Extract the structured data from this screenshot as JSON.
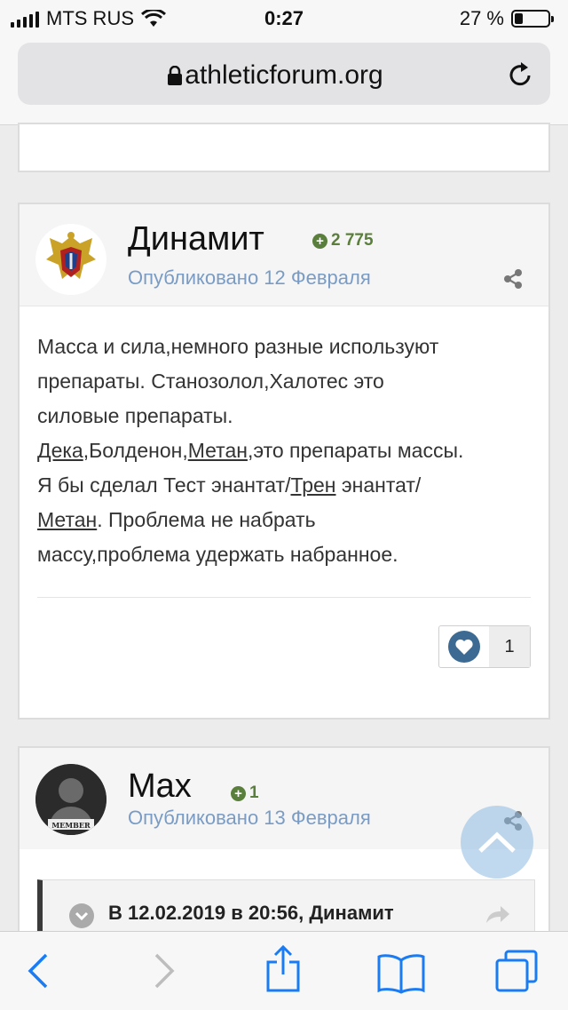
{
  "status_bar": {
    "carrier": "MTS RUS",
    "time": "0:27",
    "battery": "27 %"
  },
  "url_bar": {
    "domain": "athleticforum.org",
    "icons": [
      "lock-icon",
      "reload-icon"
    ]
  },
  "posts": [
    {
      "author": "Динамит",
      "reputation": "2 775",
      "posted": "Опубликовано 12 Февраля",
      "body": {
        "line1": "Масса и сила,немного разные используют",
        "line2": "препараты. Станозолол,Халотес это",
        "line3": "силовые препараты.",
        "deka": "Дека",
        "sep1": ",Болденон,",
        "metan1": "Метан",
        "line4_rest": ",это препараты массы.",
        "line5_pre": "Я бы сделал Тест энантат/",
        "tren": "Трен",
        "line5_post": " энантат/",
        "metan2": "Метан",
        "line6_rest": ". Проблема не набрать",
        "line7": "массу,проблема удержать набранное."
      },
      "likes": "1"
    },
    {
      "author": "Max",
      "reputation": "1",
      "posted": "Опубликовано 13 Февраля",
      "avatar_label": "MEMBER",
      "quote": "В 12.02.2019 в 20:56, Динамит"
    }
  ],
  "colors": {
    "accent_blue": "#3d6a92",
    "rep_green": "#5a7e3b",
    "ios_blue": "#1a7cf5"
  }
}
